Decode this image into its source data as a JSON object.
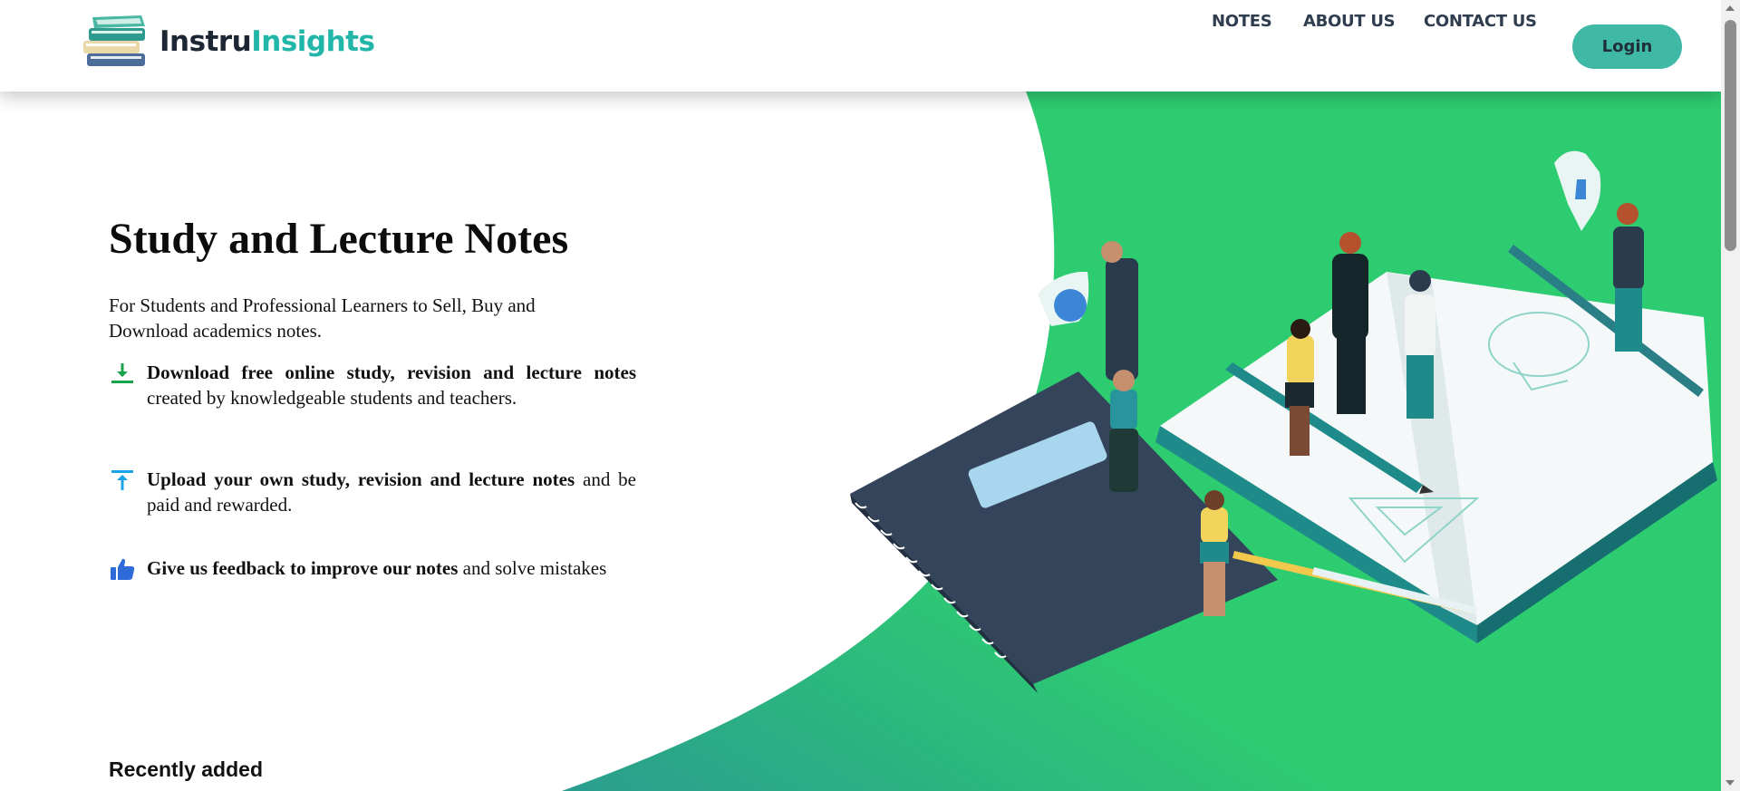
{
  "brand": {
    "name_part1": "Instru",
    "name_part2": "Insights"
  },
  "nav": {
    "notes": "NOTES",
    "about": "ABOUT US",
    "contact": "CONTACT US",
    "login": "Login"
  },
  "hero": {
    "title": "Study and Lecture Notes",
    "subtitle": "For Students and Professional Learners to Sell, Buy and Download academics notes.",
    "features": [
      {
        "icon": "download-icon",
        "bold": "Download free online study, revision and lecture notes",
        "rest": " created by knowledgeable students and teachers."
      },
      {
        "icon": "upload-icon",
        "bold": "Upload your own study, revision and lecture notes",
        "rest": " and be paid and rewarded."
      },
      {
        "icon": "thumbs-up-icon",
        "bold": "Give us feedback to improve our notes",
        "rest": " and solve mistakes"
      }
    ]
  },
  "recent": {
    "heading": "Recently added"
  },
  "colors": {
    "accent_teal": "#3fb8a5",
    "brand_teal": "#22b6a8",
    "hero_green": "#2ecc71",
    "nav_text": "#2f3d4e"
  }
}
